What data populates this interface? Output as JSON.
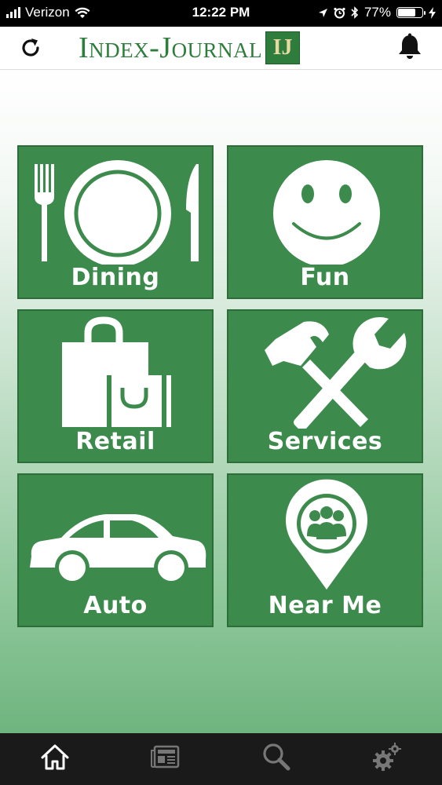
{
  "status_bar": {
    "carrier": "Verizon",
    "time": "12:22 PM",
    "battery": "77%",
    "battery_level": 0.77
  },
  "header": {
    "logo_text": "Index-Journal",
    "logo_mark": "IJ",
    "icons": [
      "refresh-icon",
      "bell-icon"
    ]
  },
  "tiles": [
    {
      "label": "Dining",
      "icon": "dining-icon"
    },
    {
      "label": "Fun",
      "icon": "smiley-icon"
    },
    {
      "label": "Retail",
      "icon": "shopping-bag-icon"
    },
    {
      "label": "Services",
      "icon": "tools-icon"
    },
    {
      "label": "Auto",
      "icon": "car-icon"
    },
    {
      "label": "Near Me",
      "icon": "location-pin-icon"
    }
  ],
  "tabbar": {
    "tabs": [
      {
        "name": "home",
        "icon": "home-icon",
        "active": true
      },
      {
        "name": "news",
        "icon": "newspaper-icon",
        "active": false
      },
      {
        "name": "search",
        "icon": "search-icon",
        "active": false
      },
      {
        "name": "settings",
        "icon": "gear-icon",
        "active": false
      }
    ]
  },
  "colors": {
    "brand_green": "#2e7d3d",
    "tile_green": "#3d8a4d",
    "tab_bar": "#1a1a1a"
  }
}
